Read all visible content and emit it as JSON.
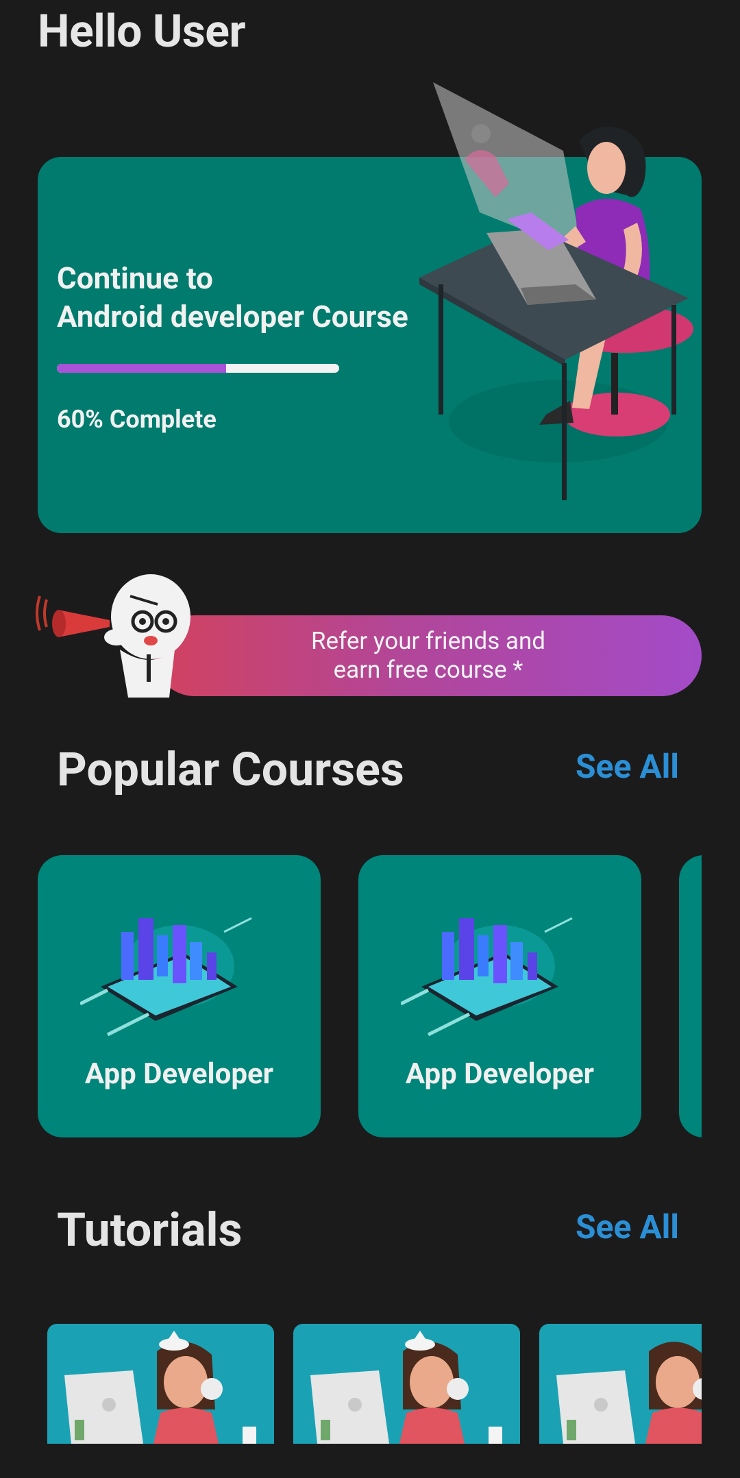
{
  "header": {
    "greeting": "Hello User"
  },
  "continue_card": {
    "title": "Continue to\nAndroid developer Course",
    "progress_label": "60% Complete",
    "progress_fraction": 0.6,
    "accent_color": "#a852d8",
    "card_color": "#007b6e"
  },
  "referral": {
    "text": "Refer your friends and\nearn free course *"
  },
  "popular_courses": {
    "title": "Popular Courses",
    "see_all": "See All",
    "items": [
      {
        "label": "App Developer"
      },
      {
        "label": "App Developer"
      }
    ]
  },
  "tutorials": {
    "title": "Tutorials",
    "see_all": "See All"
  },
  "colors": {
    "background": "#1c1b1c",
    "link": "#2b8fd6"
  }
}
